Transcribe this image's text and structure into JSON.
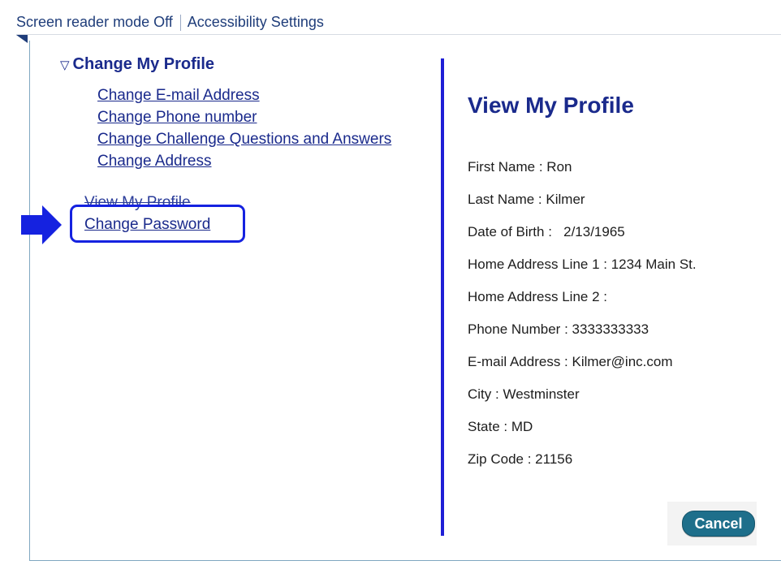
{
  "topbar": {
    "screen_reader": "Screen reader mode Off",
    "accessibility": "Accessibility Settings"
  },
  "nav": {
    "section_header": "Change My Profile",
    "sub_links": [
      "Change E-mail Address",
      "Change Phone number",
      "Change Challenge Questions and Answers",
      "Change Address"
    ],
    "main_links": [
      "View My Profile",
      "Change Password"
    ]
  },
  "profile": {
    "title": "View My Profile",
    "fields": [
      {
        "label": "First Name :",
        "value": "Ron"
      },
      {
        "label": "Last Name :",
        "value": "Kilmer"
      },
      {
        "label": "Date of Birth :",
        "value": "2/13/1965"
      },
      {
        "label": "Home Address Line 1 :",
        "value": "1234 Main St."
      },
      {
        "label": "Home Address Line 2 :",
        "value": ""
      },
      {
        "label": "Phone Number :",
        "value": "3333333333"
      },
      {
        "label": "E-mail Address :",
        "value": "Kilmer@inc.com"
      },
      {
        "label": "City :",
        "value": "Westminster"
      },
      {
        "label": "State :",
        "value": "MD"
      },
      {
        "label": "Zip Code :",
        "value": "21156"
      }
    ]
  },
  "actions": {
    "cancel": "Cancel"
  },
  "icons": {
    "collapse": "triangle-down-icon",
    "pointer": "arrow-right-icon"
  },
  "colors": {
    "link": "#1a2a8c",
    "highlight": "#1522e0",
    "cancel": "#1e6f8b"
  }
}
